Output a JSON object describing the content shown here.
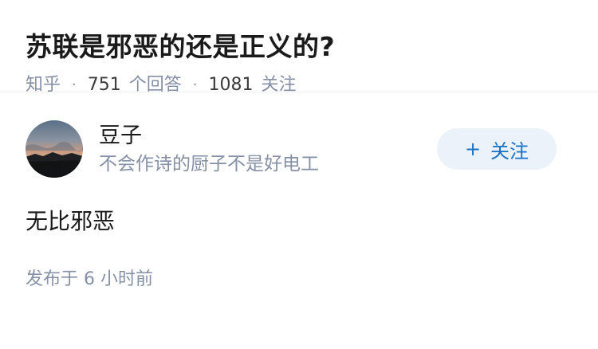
{
  "question": {
    "title": "苏联是邪恶的还是正义的?",
    "source": "知乎",
    "answer_count": "751",
    "answer_label": "个回答",
    "follow_count": "1081",
    "follow_label": "关注",
    "separator": "·"
  },
  "answer": {
    "author_name": "豆子",
    "author_bio": "不会作诗的厨子不是好电工",
    "follow_button_icon": "+",
    "follow_button_label": "关注",
    "content": "无比邪恶",
    "time": "发布于 6 小时前"
  },
  "colors": {
    "title": "#1a1a1a",
    "meta": "#8590a6",
    "follow_bg": "#ebf2fa",
    "follow_text": "#1772c6"
  }
}
